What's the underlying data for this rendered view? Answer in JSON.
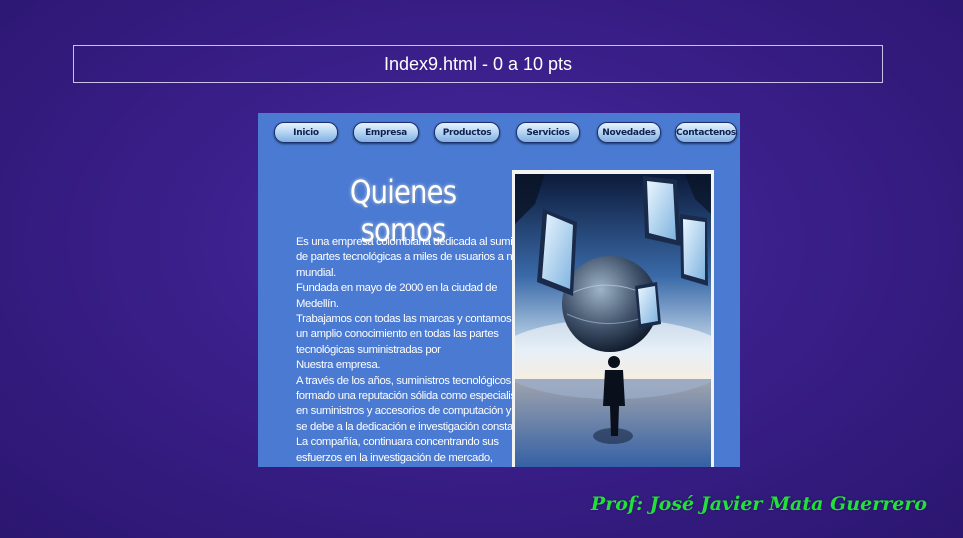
{
  "header": {
    "title": "Index9.html - 0 a 10 pts"
  },
  "site": {
    "nav": [
      "Inicio",
      "Empresa",
      "Productos",
      "Servicios",
      "Novedades",
      "Contactenos"
    ],
    "heading": "Quienes somos",
    "paragraph_lines": [
      "Es una empresa colombiana dedicada al suministro",
      "de partes tecnológicas a miles de usuarios a nivel",
      "mundial.",
      "Fundada en mayo de 2000 en la ciudad de",
      "Medellín.",
      "Trabajamos con todas las marcas y contamos con",
      "un amplio conocimiento en todas las partes",
      "tecnológicas suministradas por",
      "Nuestra empresa.",
      "A través de los años, suministros tecnológicos ha",
      "formado una reputación sólida como especialistas",
      "en suministros y accesorios de computación y esto",
      "se debe a la dedicación e investigación constante.",
      "La compañía, continuara concentrando sus",
      "esfuerzos en la investigación de mercado,"
    ]
  },
  "footer": {
    "signature": "Prof: José Javier Mata Guerrero"
  }
}
